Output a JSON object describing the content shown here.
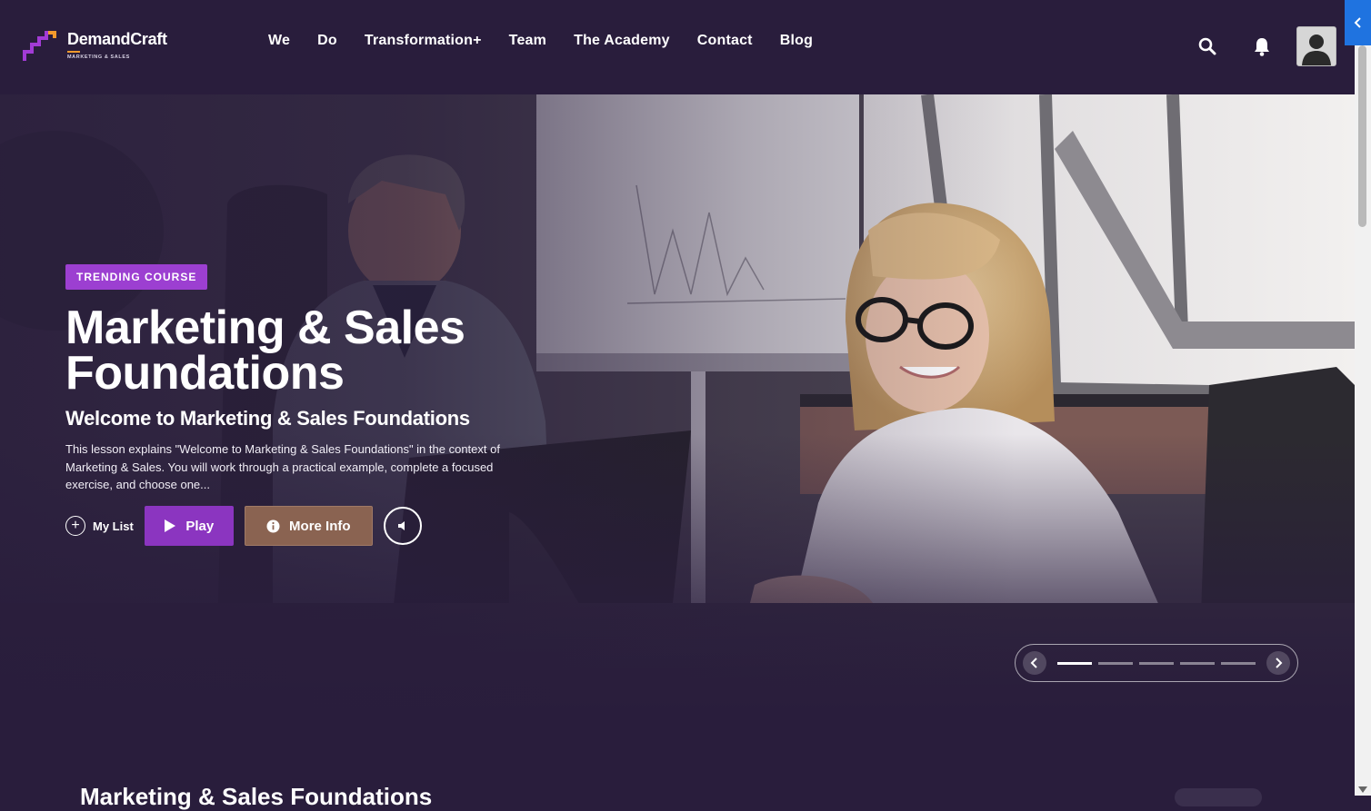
{
  "brand": {
    "name": "DemandCraft",
    "tagline": "MARKETING & SALES",
    "accent": "#f39a2c",
    "primary": "#9c3fd1"
  },
  "nav": {
    "items": [
      "We",
      "Do",
      "Transformation+",
      "Team",
      "The Academy",
      "Contact",
      "Blog"
    ],
    "icons": [
      "search-icon",
      "bell-icon",
      "avatar"
    ]
  },
  "hero": {
    "badge": "TRENDING COURSE",
    "title": "Marketing & Sales Foundations",
    "subtitle": "Welcome to Marketing & Sales Foundations",
    "description": "This lesson explains \"Welcome to Marketing & Sales Foundations\" in the context of Marketing & Sales. You will work through a practical example, complete a focused exercise, and choose one...",
    "my_list_label": "My List",
    "play_label": "Play",
    "more_info_label": "More Info",
    "slides": 5,
    "active_slide": 1
  },
  "section": {
    "title": "Marketing & Sales Foundations"
  },
  "colors": {
    "background": "#291d3c",
    "play_button": "#8b35c0",
    "info_button": "#8a6351"
  }
}
